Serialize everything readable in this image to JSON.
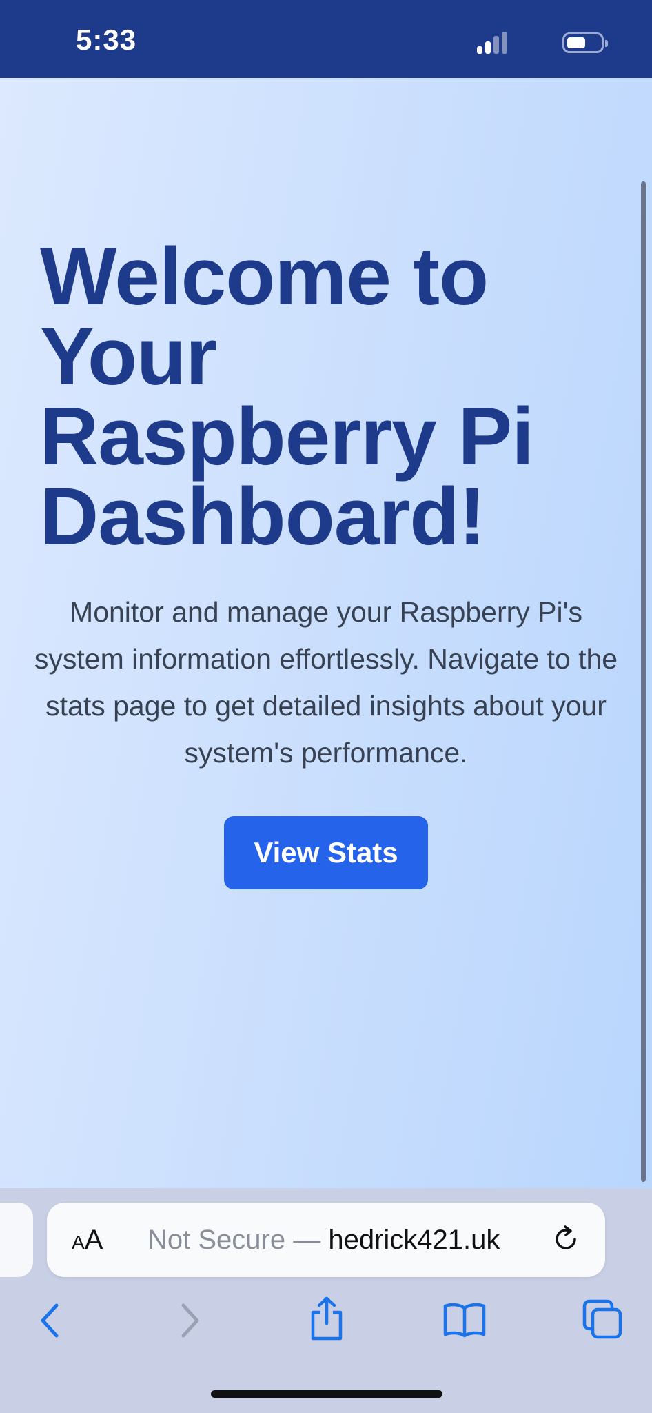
{
  "status_bar": {
    "time": "5:33",
    "icons": [
      "signal-icon",
      "battery-icon"
    ]
  },
  "page": {
    "title": "Welcome to Your Raspberry Pi Dashboard!",
    "description": "Monitor and manage your Raspberry Pi's system information effortlessly. Navigate to the stats page to get detailed insights about your system's performance.",
    "button_label": "View Stats"
  },
  "browser": {
    "text_size_label_small": "A",
    "text_size_label_large": "A",
    "url_prefix": "Not Secure — ",
    "url_domain": "hedrick421.uk",
    "toolbar_icons": [
      "back-icon",
      "forward-icon",
      "share-icon",
      "bookmarks-icon",
      "tabs-icon"
    ]
  },
  "colors": {
    "status_bar_bg": "#1e3a8a",
    "title": "#1e3a8a",
    "button_bg": "#2563eb",
    "ios_accent": "#1a73e8"
  }
}
